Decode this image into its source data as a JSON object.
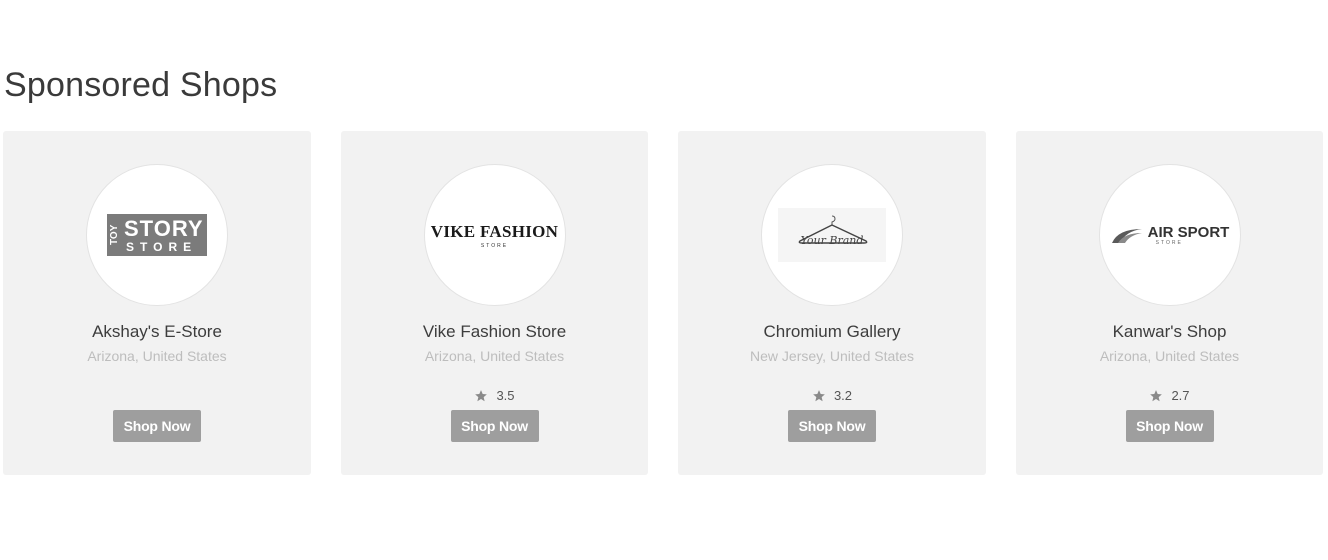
{
  "section": {
    "title": "Sponsored Shops"
  },
  "colors": {
    "card_bg": "#f2f2f2",
    "button_bg": "#9e9e9e",
    "location_text": "#bdbdbd"
  },
  "shops": [
    {
      "name": "Akshay's E-Store",
      "location": "Arizona, United States",
      "rating": null,
      "button_label": "Shop Now",
      "logo": {
        "icon": "toy-story-store-logo",
        "line1": "TOY",
        "line2": "STORY",
        "line3": "STORE"
      }
    },
    {
      "name": "Vike Fashion Store",
      "location": "Arizona, United States",
      "rating": "3.5",
      "button_label": "Shop Now",
      "logo": {
        "icon": "vike-fashion-logo",
        "line1": "VIKE FASHION",
        "line2": "STORE"
      }
    },
    {
      "name": "Chromium Gallery",
      "location": "New Jersey, United States",
      "rating": "3.2",
      "button_label": "Shop Now",
      "logo": {
        "icon": "hanger-your-brand-logo",
        "line1": "Your Brand"
      }
    },
    {
      "name": "Kanwar's Shop",
      "location": "Arizona, United States",
      "rating": "2.7",
      "button_label": "Shop Now",
      "logo": {
        "icon": "air-sport-logo",
        "line1": "AIR SPORT",
        "line2": "STORE"
      }
    }
  ]
}
